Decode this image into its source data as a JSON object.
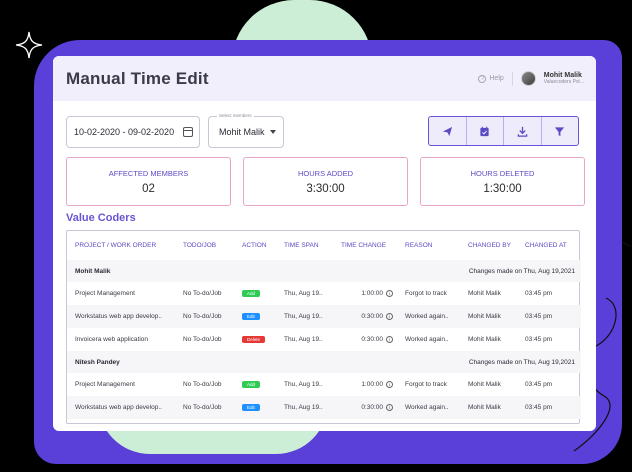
{
  "page": {
    "title": "Manual Time Edit",
    "help_label": "Help",
    "user": {
      "name": "Mohit Malik",
      "org": "Valuecoders Pvt..."
    }
  },
  "filters": {
    "date_range": "10-02-2020 - 09-02-2020",
    "member_legend": "Select members",
    "member_value": "Mohit Malik"
  },
  "toolbar": {
    "buttons": [
      {
        "icon": "send-icon"
      },
      {
        "icon": "calendar-check-icon"
      },
      {
        "icon": "download-icon"
      },
      {
        "icon": "filter-icon"
      }
    ]
  },
  "stats": [
    {
      "label": "AFFECTED MEMBERS",
      "value": "02"
    },
    {
      "label": "HOURS ADDED",
      "value": "3:30:00"
    },
    {
      "label": "HOURS DELETED",
      "value": "1:30:00"
    }
  ],
  "company": "Value Coders",
  "table": {
    "headers": [
      "PROJECT / WORK ORDER",
      "TODO/JOB",
      "ACTION",
      "TIME SPAN",
      "TIME CHANGE",
      "REASON",
      "CHANGED BY",
      "CHANGED AT"
    ],
    "groups": [
      {
        "name": "Mohit Malik",
        "note": "Changes made on Thu, Aug 19,2021",
        "rows": [
          {
            "project": "Project Management",
            "todo": "No To-do/Job",
            "action": "Add",
            "span": "Thu, Aug 19..",
            "change": "1:00:00",
            "reason": "Forgot to track",
            "by": "Mohit Malik",
            "at": "03:45 pm"
          },
          {
            "project": "Workstatus web app develop..",
            "todo": "No To-do/Job",
            "action": "Edit",
            "span": "Thu, Aug 19..",
            "change": "0:30:00",
            "reason": "Worked again..",
            "by": "Mohit Malik",
            "at": "03:45 pm"
          },
          {
            "project": "Invoicera web application",
            "todo": "No To-do/Job",
            "action": "Delete",
            "span": "Thu, Aug 19..",
            "change": "0:30:00",
            "reason": "Worked again..",
            "by": "Mohit Malik",
            "at": "03:45 pm"
          }
        ]
      },
      {
        "name": "Nitesh Pandey",
        "note": "Changes made on Thu, Aug 19,2021",
        "rows": [
          {
            "project": "Project Management",
            "todo": "No To-do/Job",
            "action": "Add",
            "span": "Thu, Aug 19..",
            "change": "1:00:00",
            "reason": "Forgot to track",
            "by": "Mohit Malik",
            "at": "03:45 pm"
          },
          {
            "project": "Workstatus web app develop..",
            "todo": "No To-do/Job",
            "action": "Edit",
            "span": "Thu, Aug 19..",
            "change": "0:30:00",
            "reason": "Worked again..",
            "by": "Mohit Malik",
            "at": "03:45 pm"
          }
        ]
      }
    ]
  },
  "colors": {
    "accent": "#5b4bc4",
    "add": "#2ecc55",
    "edit": "#1e90ff",
    "delete": "#e53935"
  }
}
